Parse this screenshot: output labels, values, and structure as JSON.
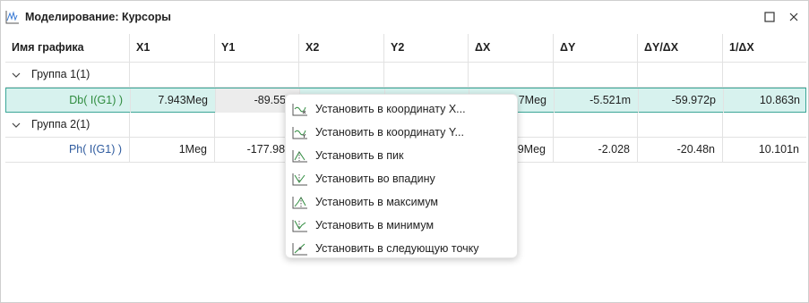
{
  "window": {
    "title": "Моделирование: Курсоры"
  },
  "columns": [
    "Имя графика",
    "X1",
    "Y1",
    "X2",
    "Y2",
    "ΔX",
    "ΔY",
    "ΔY/ΔX",
    "1/ΔX"
  ],
  "groups": [
    {
      "label": "Группа 1(1)",
      "rows": [
        {
          "name": "Db( I(G1) )",
          "name_color": "#2e8b3d",
          "x1": "7.943Meg",
          "y1": "-89.551",
          "x2": "",
          "y2": "",
          "dx": "7Meg",
          "dy": "-5.521m",
          "dydx": "-59.972p",
          "inv_dx": "10.863n",
          "selected": true
        }
      ]
    },
    {
      "label": "Группа 2(1)",
      "rows": [
        {
          "name": "Ph( I(G1) )",
          "name_color": "#2d5a9e",
          "x1": "1Meg",
          "y1": "-177.988",
          "x2": "",
          "y2": "",
          "dx": "9Meg",
          "dy": "-2.028",
          "dydx": "-20.48n",
          "inv_dx": "10.101n",
          "selected": false
        }
      ]
    }
  ],
  "context_menu": {
    "items": [
      {
        "label": "Установить в координату X...",
        "icon": "cursor-x-icon"
      },
      {
        "label": "Установить в координату Y...",
        "icon": "cursor-y-icon"
      },
      {
        "label": "Установить в пик",
        "icon": "peak-icon"
      },
      {
        "label": "Установить во впадину",
        "icon": "valley-icon"
      },
      {
        "label": "Установить в максимум",
        "icon": "maximum-icon"
      },
      {
        "label": "Установить в минимум",
        "icon": "minimum-icon"
      },
      {
        "label": "Установить в следующую точку",
        "icon": "next-point-icon"
      }
    ]
  }
}
